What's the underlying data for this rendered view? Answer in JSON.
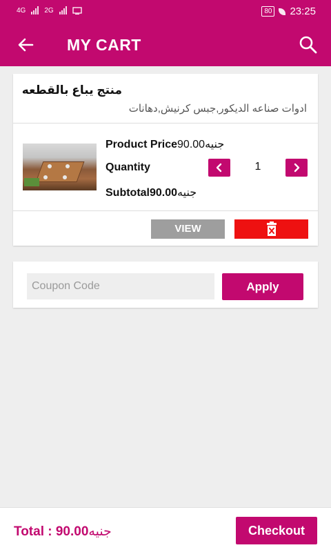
{
  "status_bar": {
    "net1": "4G",
    "net2": "2G",
    "battery": "80",
    "time": "23:25"
  },
  "app_bar": {
    "title": "MY CART",
    "back_icon": "arrow-left-icon",
    "search_icon": "search-icon"
  },
  "colors": {
    "primary": "#c2096f",
    "delete": "#ee1111",
    "view": "#9e9e9e"
  },
  "cart_item": {
    "name": "منتج يباع بالقطعه",
    "category": "ادوات صناعه الديكور,جبس كرنيش,دهانات",
    "price_label": "Product Price",
    "price_value": "90.00",
    "currency": "جنيه",
    "quantity_label": "Quantity",
    "quantity_value": "1",
    "subtotal_label": "Subtotal",
    "subtotal_value": "90.00",
    "view_label": "VIEW",
    "delete_icon": "trash-icon"
  },
  "coupon": {
    "placeholder": "Coupon Code",
    "apply_label": "Apply"
  },
  "footer": {
    "total_label": "Total : ",
    "total_value": "90.00",
    "currency": "جنيه",
    "checkout_label": "Checkout"
  }
}
